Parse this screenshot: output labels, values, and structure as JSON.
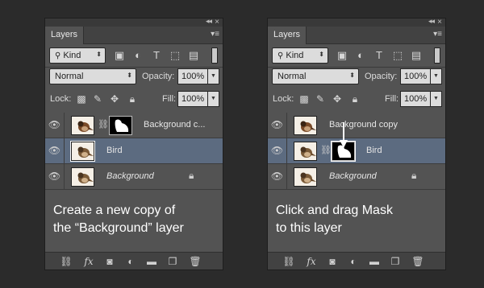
{
  "panels": [
    {
      "tab_label": "Layers",
      "kind_label": "Kind",
      "blend_mode": "Normal",
      "opacity_label": "Opacity:",
      "opacity_value": "100%",
      "lock_label": "Lock:",
      "fill_label": "Fill:",
      "fill_value": "100%",
      "layers": [
        {
          "name": "Background c...",
          "has_mask": true,
          "selected": false,
          "italic": false,
          "locked": false
        },
        {
          "name": "Bird",
          "has_mask": false,
          "selected": true,
          "italic": false,
          "locked": false
        },
        {
          "name": "Background",
          "has_mask": false,
          "selected": false,
          "italic": true,
          "locked": true
        }
      ],
      "caption_line1": "Create a new copy of",
      "caption_line2": "the “Background” layer"
    },
    {
      "tab_label": "Layers",
      "kind_label": "Kind",
      "blend_mode": "Normal",
      "opacity_label": "Opacity:",
      "opacity_value": "100%",
      "lock_label": "Lock:",
      "fill_label": "Fill:",
      "fill_value": "100%",
      "layers": [
        {
          "name": "Background copy",
          "has_mask": false,
          "selected": false,
          "italic": false,
          "locked": false
        },
        {
          "name": "Bird",
          "has_mask": true,
          "selected": true,
          "italic": false,
          "locked": false
        },
        {
          "name": "Background",
          "has_mask": false,
          "selected": false,
          "italic": true,
          "locked": true
        }
      ],
      "caption_line1": "Click and drag Mask",
      "caption_line2": "to this layer"
    }
  ],
  "icons": {
    "filter": [
      "image-filter-icon",
      "adjustment-filter-icon",
      "type-filter-icon",
      "shape-filter-icon",
      "smart-object-filter-icon"
    ],
    "lock": [
      "lock-transparent-icon",
      "lock-image-icon",
      "lock-position-icon",
      "lock-all-icon"
    ],
    "footer": [
      "link-layers-icon",
      "fx-icon",
      "add-mask-icon",
      "adjustment-layer-icon",
      "group-folder-icon",
      "new-layer-icon",
      "trash-icon"
    ]
  },
  "colors": {
    "panel_bg": "#535353",
    "selected_row": "#5c6b80",
    "page_bg": "#2b2b2b"
  }
}
